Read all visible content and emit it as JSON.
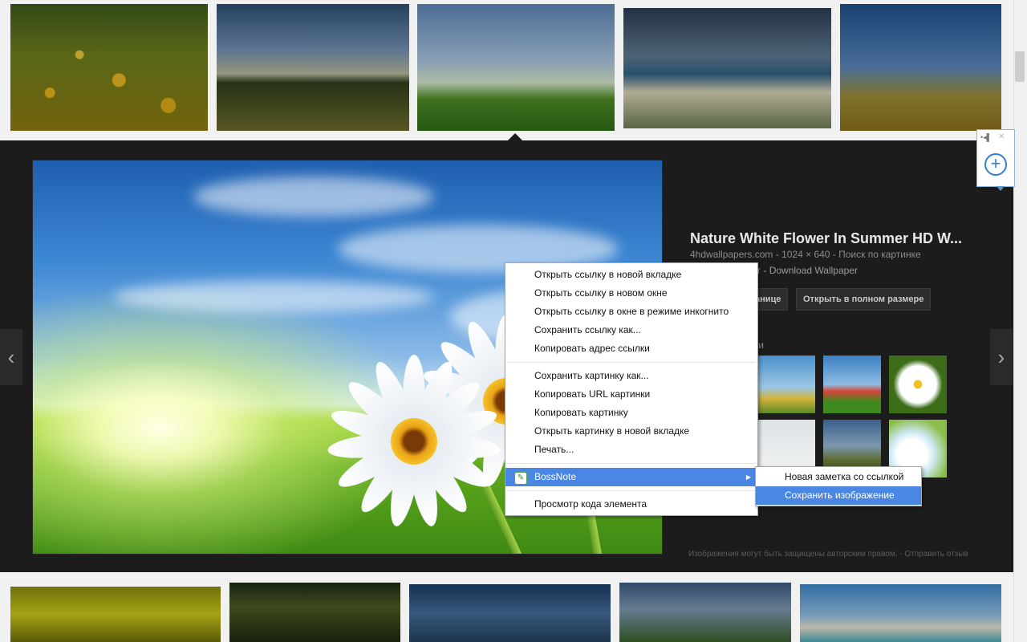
{
  "preview": {
    "title": "Nature White Flower In Summer HD W...",
    "meta": "4hdwallpapers.com - 1024 × 640 - Поиск по картинке",
    "description": "ower In Summer - Download Wallpaper",
    "btn_page": "анице",
    "btn_fullsize": "Открыть в полном размере",
    "related_heading": "ки",
    "footer": "Изображения могут быть защищены авторским правом. - Отправить отзыв"
  },
  "nav": {
    "prev": "‹",
    "next": "›"
  },
  "extension": {
    "pin": "•◂▌",
    "close": "✕",
    "plus": "+"
  },
  "context_menu": {
    "items": [
      "Открыть ссылку в новой вкладке",
      "Открыть ссылку в новом окне",
      "Открыть ссылку в окне в режиме инкогнито",
      "Сохранить ссылку как...",
      "Копировать адрес ссылки",
      "Сохранить картинку как...",
      "Копировать URL картинки",
      "Копировать картинку",
      "Открыть картинку в новой вкладке",
      "Печать...",
      "BossNote",
      "Просмотр кода элемента"
    ],
    "bossnote_icon": "✎",
    "submenu_arrow": "▶"
  },
  "submenu": {
    "items": [
      "Новая заметка со ссылкой",
      "Сохранить изображение"
    ]
  }
}
